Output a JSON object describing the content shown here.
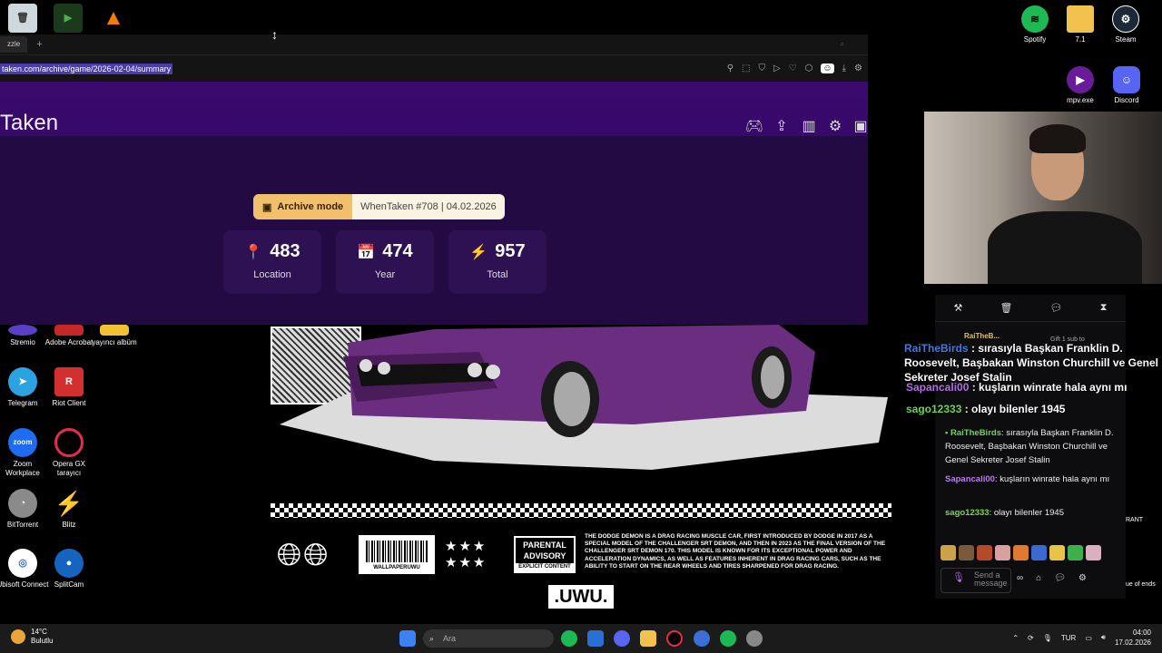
{
  "desktop_left": [
    {
      "name": "recycle-bin",
      "label": "",
      "color": "#cfd8dc"
    },
    {
      "name": "app-green",
      "label": "",
      "color": "#2e7d32"
    },
    {
      "name": "vlc",
      "label": "",
      "color": "#f57c00"
    },
    {
      "name": "stremio",
      "label": "Stremio",
      "color": "#5b3fc4"
    },
    {
      "name": "adobe-acrobat",
      "label": "Adobe Acrobat",
      "color": "#c62828"
    },
    {
      "name": "yayinci-album",
      "label": "yayıncı albüm",
      "color": "#f1c232"
    },
    {
      "name": "telegram",
      "label": "Telegram",
      "color": "#2aa3e0"
    },
    {
      "name": "riot-client",
      "label": "Riot Client",
      "color": "#d32f2f"
    },
    {
      "name": "zoom",
      "label": "Zoom Workplace",
      "color": "#1f6bf2"
    },
    {
      "name": "opera-gx",
      "label": "Opera GX tarayıcı",
      "color": "#e52b50"
    },
    {
      "name": "bittorrent",
      "label": "BitTorrent",
      "color": "#8a8a8a"
    },
    {
      "name": "blitz",
      "label": "Blitz",
      "color": "#e8153c"
    },
    {
      "name": "ubisoft-connect",
      "label": "Ubisoft Connect",
      "color": "#3a6fd8"
    },
    {
      "name": "splitcam",
      "label": "SplitCam",
      "color": "#1565c0"
    }
  ],
  "desktop_right": [
    {
      "name": "spotify",
      "label": "Spotify",
      "color": "#1db954"
    },
    {
      "name": "folder-71",
      "label": "7.1",
      "color": "#f2c14e"
    },
    {
      "name": "steam",
      "label": "Steam",
      "color": "#1b2838"
    },
    {
      "name": "mpv",
      "label": "mpv.exe",
      "color": "#6a1b9a"
    },
    {
      "name": "discord",
      "label": "Discord",
      "color": "#5865f2"
    }
  ],
  "browser": {
    "tab_label": "zzle",
    "url": "taken.com/archive/game/2026-02-04/summary",
    "site_title": "Taken",
    "archive_mode": "Archive mode",
    "archive_info": "WhenTaken #708 | 04.02.2026",
    "stats": [
      {
        "icon": "location-pin-icon",
        "glyph": "📍",
        "value": "483",
        "label": "Location"
      },
      {
        "icon": "calendar-icon",
        "glyph": "📅",
        "value": "474",
        "label": "Year"
      },
      {
        "icon": "lightning-icon",
        "glyph": "⚡",
        "value": "957",
        "label": "Total"
      }
    ]
  },
  "wallpaper": {
    "barcode_text": "WALLPAPERUWU",
    "advisory_title": "PARENTAL ADVISORY",
    "advisory_sub": "EXPLICIT CONTENT",
    "description": "THE DODGE DEMON IS A DRAG RACING MUSCLE CAR, FIRST INTRODUCED BY DODGE IN 2017 AS A SPECIAL MODEL OF THE CHALLENGER SRT DEMON, AND THEN IN 2023 AS THE FINAL VERSION OF THE CHALLENGER SRT DEMON 170. THIS MODEL IS KNOWN FOR ITS EXCEPTIONAL POWER AND ACCELERATION DYNAMICS, AS WELL AS FEATURES INHERENT IN DRAG RACING CARS, SUCH AS THE ABILITY TO START ON THE REAR WHEELS AND TIRES SHARPENED FOR DRAG RACING.",
    "logo": ".UWU."
  },
  "chat": {
    "gift_user": "RaiTheB...",
    "gift_text": "Gift 1 sub to",
    "overlay": [
      {
        "user": "RaiTheBirds",
        "user_color": "#3d7be0",
        "text": " : sırasıyla Başkan Franklin D. Roosevelt, Başbakan Winston Churchill ve Genel Sekreter Josef Stalin"
      },
      {
        "user": "Sapancali00",
        "user_color": "#b46ce8",
        "text": " : kuşların winrate hala aynı mı"
      },
      {
        "user": "sago12333",
        "user_color": "#6ad44a",
        "text": " : olayı bilenler 1945"
      }
    ],
    "messages": [
      {
        "user": "RaiTheBirds",
        "user_color": "#6fd35a",
        "text": ": sırasıyla Başkan Franklin D. Roosevelt, Başbakan Winston Churchill ve Genel Sekreter Josef Stalin"
      },
      {
        "user": "Sapancali00",
        "user_color": "#b97cf0",
        "text": ": kuşların winrate hala aynı mı"
      },
      {
        "user": "sago12333",
        "user_color": "#7fd64c",
        "text": ": olayı bilenler 1945"
      }
    ],
    "placeholder": "Send a message",
    "side_label": "RANT",
    "side_label2": "ue of ends"
  },
  "taskbar": {
    "temp": "14°C",
    "weather": "Bulutlu",
    "search_placeholder": "Ara",
    "lang": "TUR",
    "time": "04:00",
    "date": "17.02.2026"
  }
}
